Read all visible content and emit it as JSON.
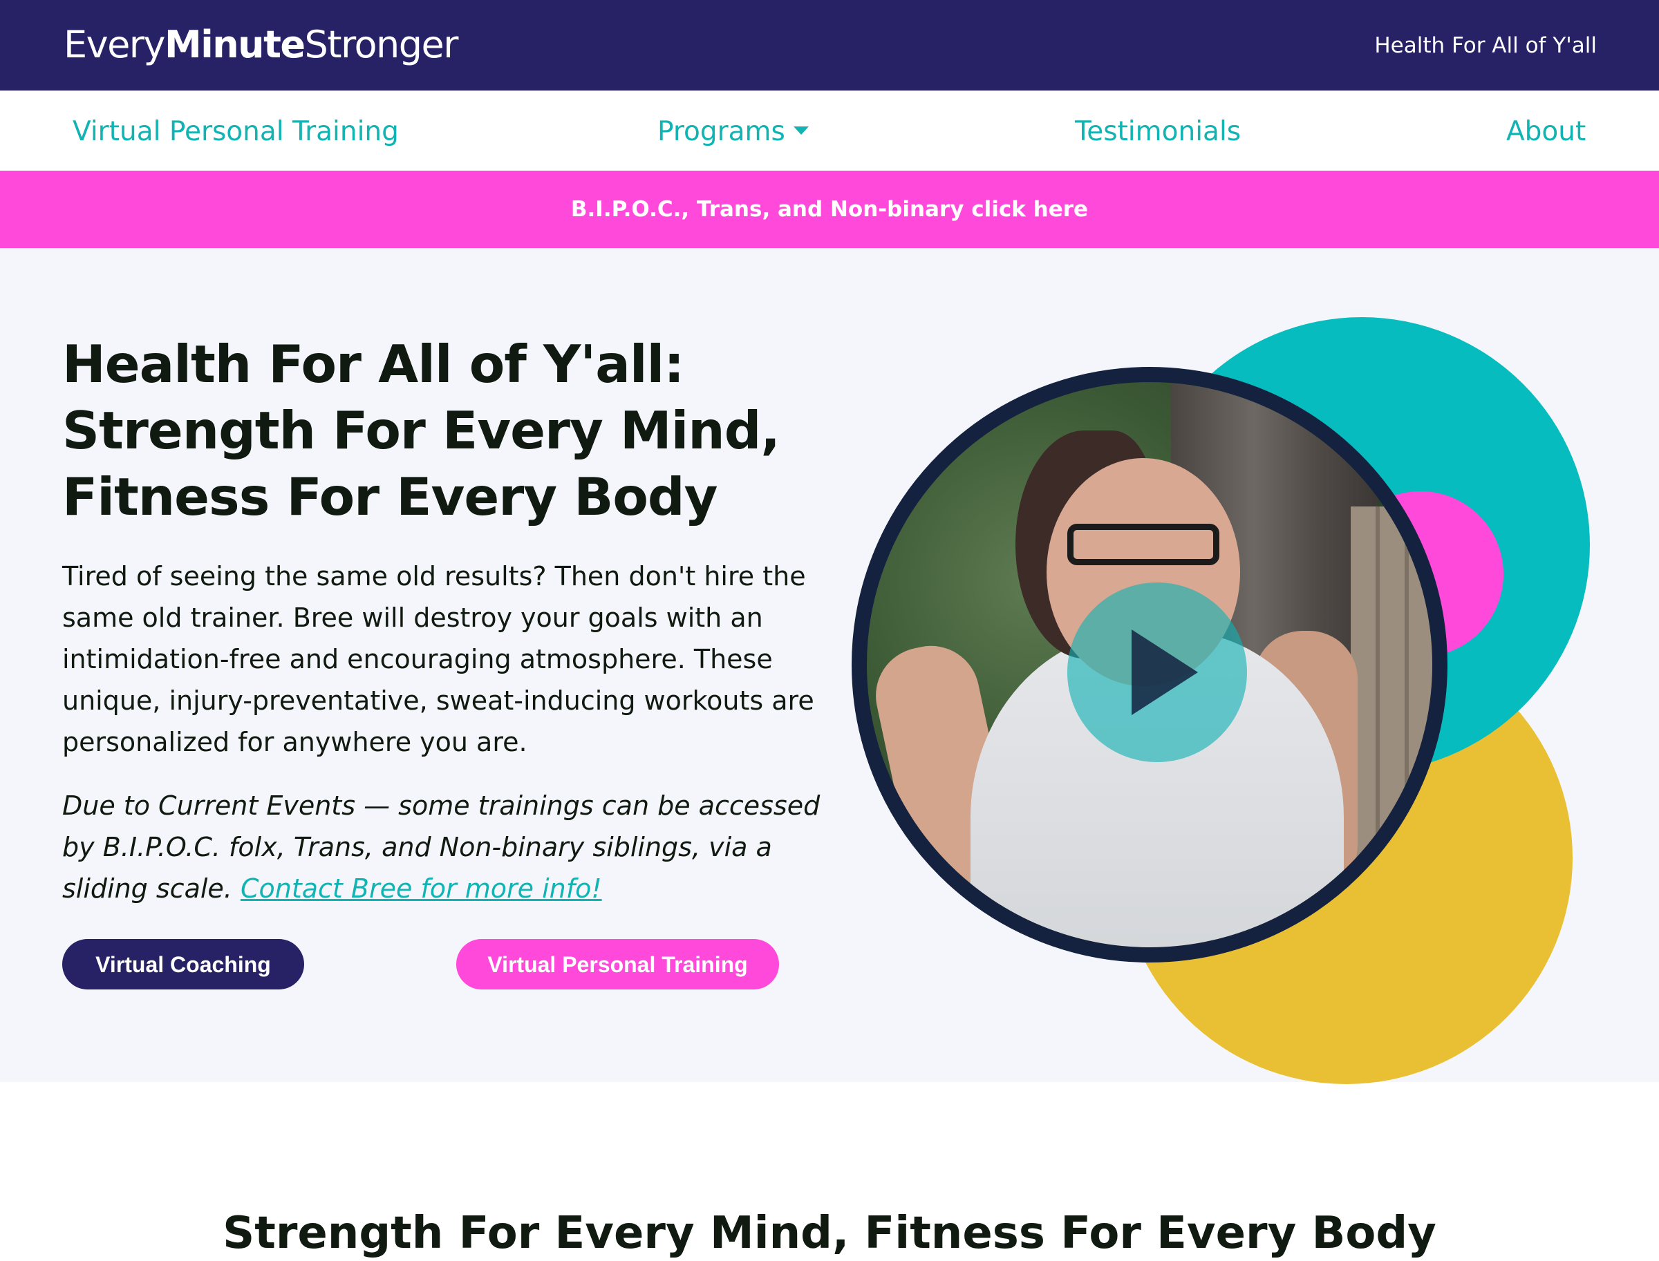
{
  "topbar": {
    "logo_every": "Every",
    "logo_minute": "Minute",
    "logo_stronger": "Stronger",
    "tagline": "Health For All of Y'all"
  },
  "nav": {
    "items": [
      {
        "label": "Virtual Personal Training"
      },
      {
        "label": "Programs"
      },
      {
        "label": "Testimonials"
      },
      {
        "label": "About"
      }
    ]
  },
  "banner": {
    "text": "B.I.P.O.C., Trans, and Non-binary click here"
  },
  "hero": {
    "title_line1": "Health For All of Y'all:",
    "title_line2": "Strength For Every Mind,",
    "title_line3": "Fitness For Every Body",
    "body": "Tired of seeing the same old results? Then don't hire the same old trainer. Bree will destroy your goals with an intimidation-free and encouraging atmosphere. These unique, injury-preventative, sweat-inducing workouts are personalized for anywhere you are.",
    "note": "Due to Current Events — some trainings can be accessed by B.I.P.O.C. folx, Trans, and Non-binary siblings, via a sliding scale.",
    "note_link": "Contact Bree for more info!",
    "button_coaching": "Virtual Coaching",
    "button_training": "Virtual Personal Training"
  },
  "section2": {
    "title": "Strength For Every Mind, Fitness For Every Body"
  },
  "colors": {
    "navy": "#262265",
    "teal": "#11b3b3",
    "pink": "#ff49da",
    "yellow": "#e9c033",
    "hero_bg": "#f4f6fb"
  }
}
